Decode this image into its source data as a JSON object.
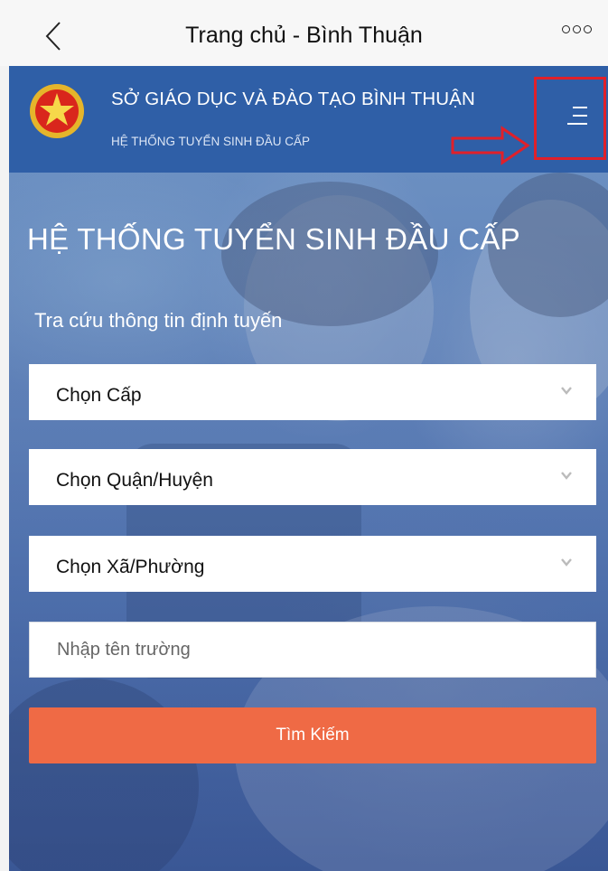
{
  "navbar": {
    "title": "Trang chủ - Bình Thuận",
    "back_icon": "chevron-left-icon",
    "more_icon": "more-circles-icon"
  },
  "header": {
    "org_name": "SỞ GIÁO DỤC VÀ ĐÀO TẠO BÌNH THUẬN",
    "org_subtitle": "HỆ THỐNG TUYỂN SINH ĐẦU CẤP",
    "emblem_icon": "national-emblem-icon",
    "menu_icon": "hamburger-menu-icon",
    "highlight_color": "#e0202a"
  },
  "hero": {
    "title": "HỆ THỐNG TUYỂN SINH ĐẦU CẤP",
    "subtitle": "Tra cứu thông tin định tuyến"
  },
  "form": {
    "level_select": "Chọn Cấp",
    "district_select": "Chọn Quận/Huyện",
    "ward_select": "Chọn Xã/Phường",
    "school_placeholder": "Nhập tên trường",
    "search_label": "Tìm Kiếm"
  },
  "colors": {
    "header_blue": "#2f5fa7",
    "button_orange": "#ef6a45"
  }
}
